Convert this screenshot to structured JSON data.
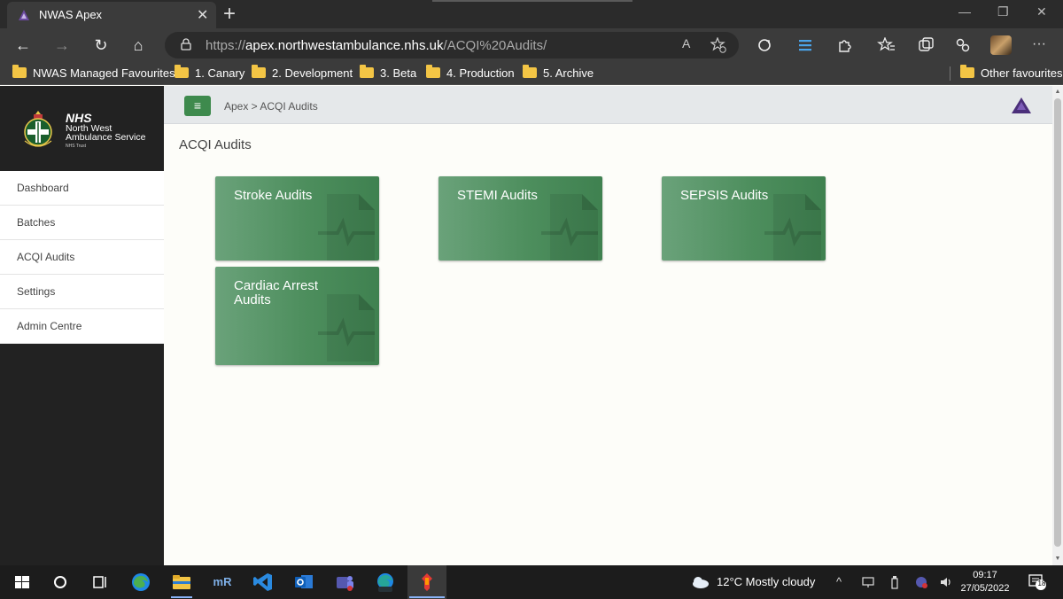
{
  "browser": {
    "tab_title": "NWAS Apex",
    "tab_close": "✕",
    "new_tab": "+",
    "window_controls": {
      "minimize": "—",
      "restore": "❐",
      "close": "✕"
    },
    "nav": {
      "back": "←",
      "forward": "→",
      "refresh": "↻",
      "home": "⌂"
    },
    "url_scheme": "https://",
    "url_host": "apex.northwestambulance.nhs.uk",
    "url_path": "/ACQI%20Audits/",
    "read_aloud": "A",
    "favourites": [
      {
        "label": "NWAS Managed Favourites"
      },
      {
        "label": "1. Canary"
      },
      {
        "label": "2. Development"
      },
      {
        "label": "3. Beta"
      },
      {
        "label": "4. Production"
      },
      {
        "label": "5. Archive"
      }
    ],
    "other_favourites": "Other favourites",
    "more": "···"
  },
  "app": {
    "brand": {
      "nhs": "NHS",
      "org_line1": "North West",
      "org_line2": "Ambulance Service",
      "trust": "NHS Trust"
    },
    "menu_button": "≡",
    "breadcrumb": "Apex > ACQI Audits",
    "sidebar": [
      {
        "label": "Dashboard"
      },
      {
        "label": "Batches"
      },
      {
        "label": "ACQI Audits"
      },
      {
        "label": "Settings"
      },
      {
        "label": "Admin Centre"
      }
    ],
    "page_title": "ACQI Audits",
    "cards": [
      {
        "title": "Stroke Audits"
      },
      {
        "title": "STEMI Audits"
      },
      {
        "title": "SEPSIS Audits"
      },
      {
        "title": "Cardiac Arrest Audits"
      }
    ]
  },
  "taskbar": {
    "weather": "12°C  Mostly cloudy",
    "time": "09:17",
    "date": "27/05/2022",
    "notifications": "18",
    "icons": [
      "windows-start-icon",
      "search-circle-icon",
      "task-view-icon",
      "edge-icon",
      "file-explorer-icon",
      "mremoteng-icon",
      "vscode-icon",
      "outlook-icon",
      "teams-icon",
      "edge-beta-icon",
      "pinned-app-icon"
    ],
    "mremote_label": "mR"
  },
  "colors": {
    "accent_green": "#3e8a4d",
    "card_green": "#4d8e5d",
    "sidebar_dark": "#222222"
  }
}
